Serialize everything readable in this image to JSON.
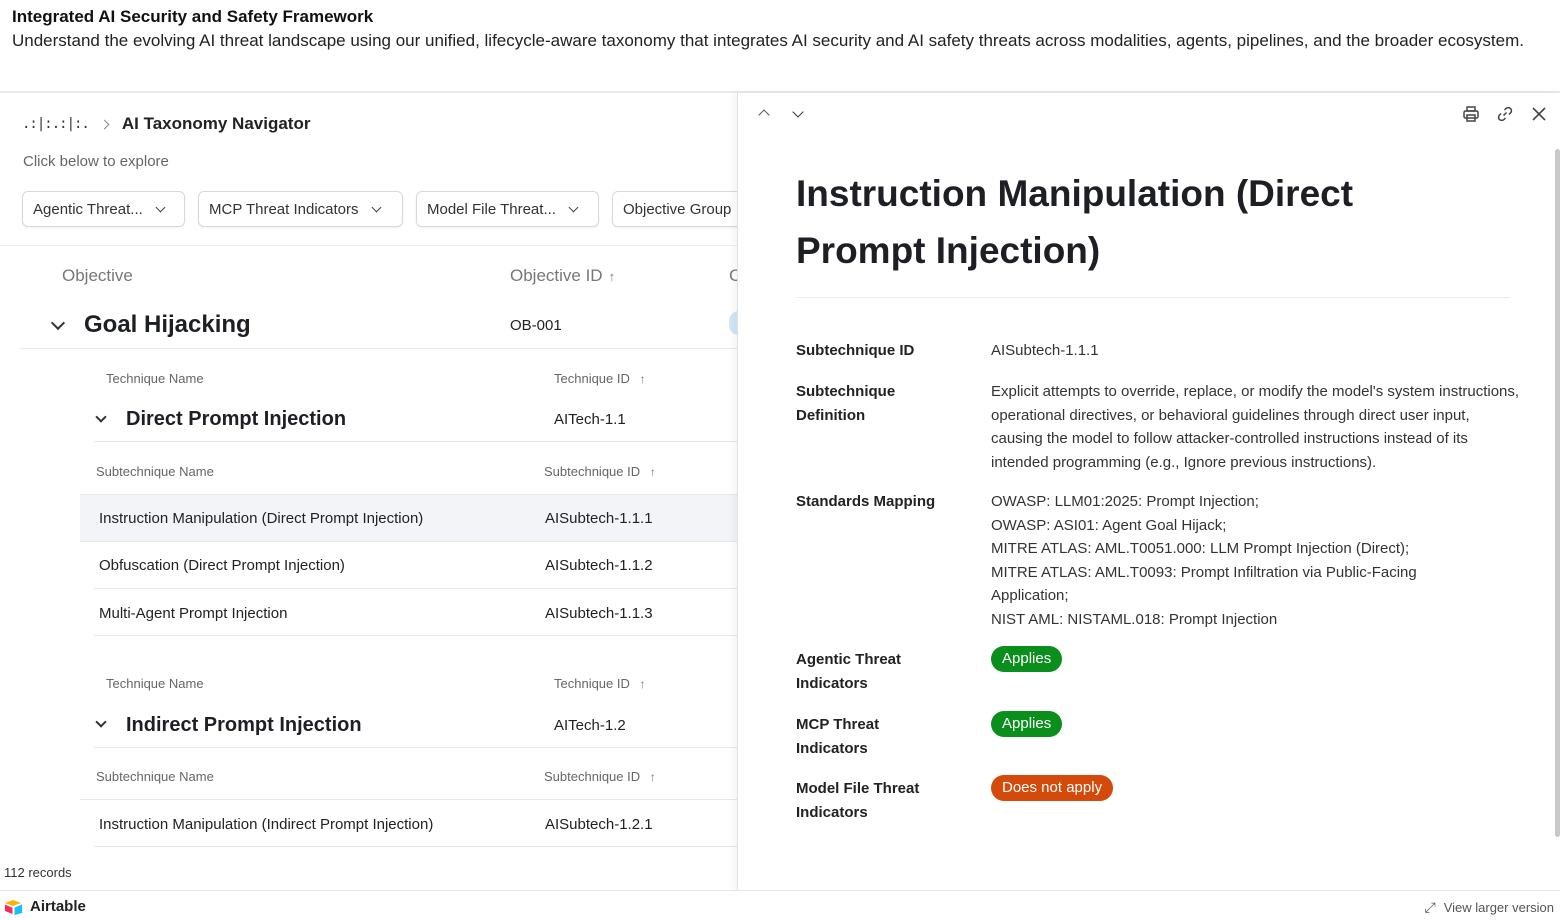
{
  "page": {
    "title": "Integrated AI Security and Safety Framework",
    "description": "Understand the evolving AI threat landscape using our unified, lifecycle-aware taxonomy that integrates AI security and AI safety threats across modalities, agents, pipelines, and the broader ecosystem."
  },
  "app": {
    "logo_glyph": ".:|:.:|:.",
    "title": "AI Taxonomy Navigator",
    "hint": "Click below to explore"
  },
  "filters": [
    {
      "label": "Agentic Threat..."
    },
    {
      "label": "MCP Threat Indicators"
    },
    {
      "label": "Model File Threat..."
    },
    {
      "label": "Objective Group"
    }
  ],
  "table": {
    "objective_header": "Objective",
    "objective_id_header": "Objective ID",
    "objective_id_sort": "↑",
    "third_header_cut": "C",
    "group": {
      "name": "Goal Hijacking",
      "id": "OB-001"
    },
    "techniques": [
      {
        "name_header": "Technique Name",
        "id_header": "Technique ID",
        "sort": "↑",
        "name": "Direct Prompt Injection",
        "id": "AITech-1.1",
        "sub_name_header": "Subtechnique Name",
        "sub_id_header": "Subtechnique ID",
        "rows": [
          {
            "name": "Instruction Manipulation (Direct Prompt Injection)",
            "id": "AISubtech-1.1.1"
          },
          {
            "name": "Obfuscation (Direct Prompt Injection)",
            "id": "AISubtech-1.1.2"
          },
          {
            "name": "Multi-Agent Prompt Injection",
            "id": "AISubtech-1.1.3"
          }
        ]
      },
      {
        "name_header": "Technique Name",
        "id_header": "Technique ID",
        "sort": "↑",
        "name": "Indirect Prompt Injection",
        "id": "AITech-1.2",
        "sub_name_header": "Subtechnique Name",
        "sub_id_header": "Subtechnique ID",
        "rows": [
          {
            "name": "Instruction Manipulation (Indirect Prompt Injection)",
            "id": "AISubtech-1.2.1"
          }
        ]
      }
    ],
    "records": "112 records"
  },
  "detail": {
    "title": "Instruction Manipulation (Direct Prompt Injection)",
    "fields": {
      "subtech_id_label": "Subtechnique ID",
      "subtech_id_value": "AISubtech-1.1.1",
      "definition_label": "Subtechnique Definition",
      "definition_value": "Explicit attempts to override, replace, or modify the model's system instructions, operational directives, or behavioral guidelines through direct user input, causing the model to follow attacker-controlled instructions instead of its intended programming (e.g., Ignore previous instructions).",
      "mapping_label": "Standards Mapping",
      "mapping_lines": [
        "OWASP: LLM01:2025: Prompt Injection;",
        "OWASP: ASI01: Agent Goal Hijack;",
        "MITRE ATLAS: AML.T0051.000: LLM Prompt Injection (Direct);",
        "MITRE ATLAS: AML.T0093: Prompt Infiltration via Public-Facing Application;",
        "NIST AML: NISTAML.018: Prompt Injection"
      ],
      "agentic_label": "Agentic Threat Indicators",
      "agentic_value": "Applies",
      "mcp_label": "MCP Threat Indicators",
      "mcp_value": "Applies",
      "model_file_label": "Model File Threat Indicators",
      "model_file_value": "Does not apply"
    },
    "colors": {
      "applies": "#0a8f1c",
      "does_not_apply": "#d44a0a"
    }
  },
  "footer": {
    "brand": "Airtable",
    "view_larger": "View larger version"
  }
}
